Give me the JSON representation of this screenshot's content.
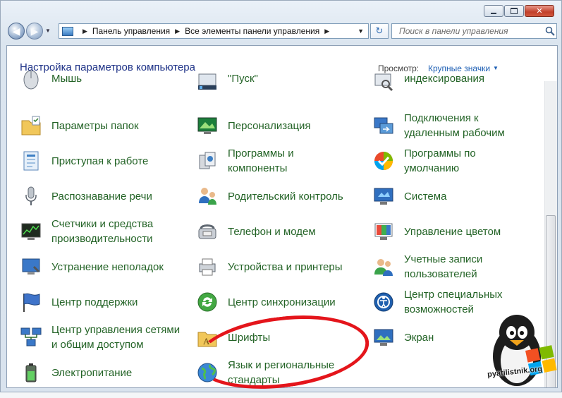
{
  "window": {
    "caption": {
      "minimize": "minimize",
      "maximize": "maximize",
      "close": "close"
    }
  },
  "nav": {
    "breadcrumb": [
      "Панель управления",
      "Все элементы панели управления"
    ],
    "search_placeholder": "Поиск в панели управления"
  },
  "header": {
    "title": "Настройка параметров компьютера",
    "view_by_label": "Просмотр:",
    "view_by_value": "Крупные значки"
  },
  "columns": [
    [
      {
        "label": "Мышь",
        "icon": "mouse-icon"
      },
      {
        "label": "Параметры папок",
        "icon": "folder-options-icon"
      },
      {
        "label": "Приступая к работе",
        "icon": "getting-started-icon"
      },
      {
        "label": "Распознавание речи",
        "icon": "microphone-icon"
      },
      {
        "label": "Счетчики и средства\nпроизводительности",
        "icon": "performance-icon"
      },
      {
        "label": "Устранение неполадок",
        "icon": "troubleshooting-icon"
      },
      {
        "label": "Центр поддержки",
        "icon": "action-center-flag-icon"
      },
      {
        "label": "Центр управления сетями\nи общим доступом",
        "icon": "network-icon"
      },
      {
        "label": "Электропитание",
        "icon": "battery-icon"
      }
    ],
    [
      {
        "label": "\"Пуск\"",
        "icon": "taskbar-icon"
      },
      {
        "label": "Персонализация",
        "icon": "personalization-icon"
      },
      {
        "label": "Программы и\nкомпоненты",
        "icon": "programs-icon"
      },
      {
        "label": "Родительский контроль",
        "icon": "parental-control-icon"
      },
      {
        "label": "Телефон и модем",
        "icon": "phone-modem-icon"
      },
      {
        "label": "Устройства и принтеры",
        "icon": "printer-icon"
      },
      {
        "label": "Центр синхронизации",
        "icon": "sync-icon"
      },
      {
        "label": "Шрифты",
        "icon": "fonts-folder-icon"
      },
      {
        "label": "Язык и региональные\nстандарты",
        "icon": "globe-icon"
      }
    ],
    [
      {
        "label": "индексирования",
        "icon": "indexing-icon"
      },
      {
        "label": "Подключения к\nудаленным рабочим",
        "icon": "remote-desktop-icon"
      },
      {
        "label": "Программы по\nумолчанию",
        "icon": "default-programs-icon"
      },
      {
        "label": "Система",
        "icon": "system-icon"
      },
      {
        "label": "Управление цветом",
        "icon": "color-management-icon"
      },
      {
        "label": "Учетные записи\nпользователей",
        "icon": "user-accounts-icon"
      },
      {
        "label": "Центр специальных\nвозможностей",
        "icon": "accessibility-icon"
      },
      {
        "label": "Экран",
        "icon": "display-icon"
      }
    ]
  ],
  "watermark": {
    "text": "pyatilistnik.org"
  },
  "colors": {
    "link_green": "#236326",
    "title_blue": "#1e3287",
    "highlight_red": "#e4151b"
  }
}
